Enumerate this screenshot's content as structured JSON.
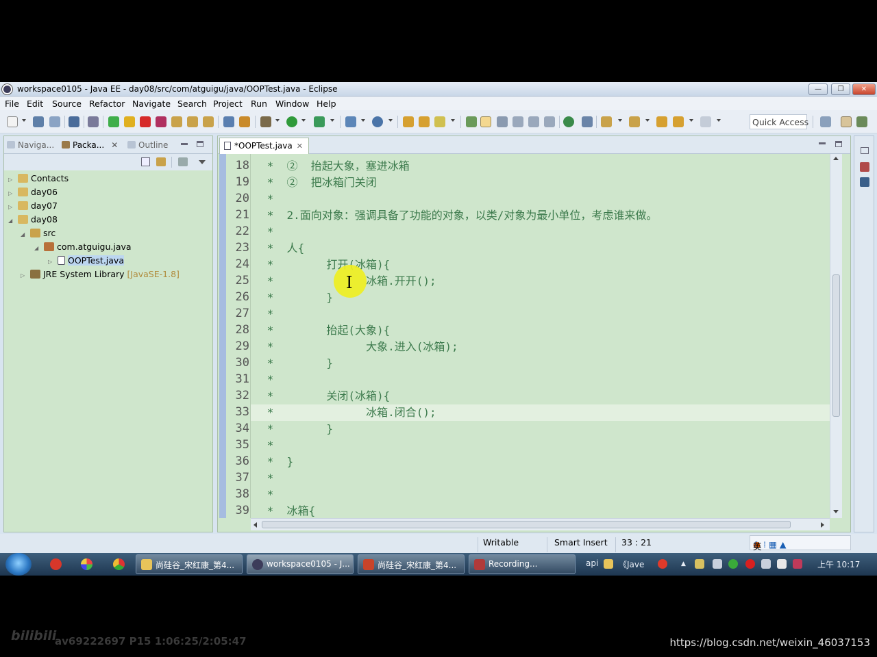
{
  "window": {
    "title": "workspace0105 - Java EE - day08/src/com/atguigu/java/OOPTest.java - Eclipse",
    "controls": [
      "—",
      "❐",
      "✕"
    ]
  },
  "menu": [
    "File",
    "Edit",
    "Source",
    "Refactor",
    "Navigate",
    "Search",
    "Project",
    "Run",
    "Window",
    "Help"
  ],
  "toolbar": {
    "quick_access": "Quick Access"
  },
  "left_panel": {
    "tabs": [
      {
        "label": "Naviga...",
        "active": false
      },
      {
        "label": "Packa...",
        "active": true
      },
      {
        "label": "Outline",
        "active": false
      }
    ],
    "tab_close": "✕",
    "tree": [
      {
        "label": "Contacts",
        "depth": 0,
        "toggle": "▷"
      },
      {
        "label": "day06",
        "depth": 0,
        "toggle": "▷"
      },
      {
        "label": "day07",
        "depth": 0,
        "toggle": "▷"
      },
      {
        "label": "day08",
        "depth": 0,
        "toggle": "◢"
      },
      {
        "label": "src",
        "depth": 1,
        "toggle": "◢"
      },
      {
        "label": "com.atguigu.java",
        "depth": 2,
        "toggle": "◢"
      },
      {
        "label": "OOPTest.java",
        "depth": 3,
        "toggle": "▷"
      },
      {
        "label": "JRE System Library",
        "suffix": "[JavaSE-1.8]",
        "depth": 1,
        "toggle": "▷"
      }
    ]
  },
  "editor": {
    "tab_label": "*OOPTest.java",
    "tab_close": "✕",
    "current_line": 33,
    "lines": [
      {
        "n": "18",
        "text": " *  ②  抬起大象，塞进冰箱"
      },
      {
        "n": "19",
        "text": " *  ②  把冰箱门关闭"
      },
      {
        "n": "20",
        "text": " *"
      },
      {
        "n": "21",
        "text": " *  2.面向对象：强调具备了功能的对象，以类/对象为最小单位，考虑谁来做。"
      },
      {
        "n": "22",
        "text": " *"
      },
      {
        "n": "23",
        "text": " *  人{"
      },
      {
        "n": "24",
        "text": " *        打开(冰箱){"
      },
      {
        "n": "25",
        "text": " *              冰箱.开开();"
      },
      {
        "n": "26",
        "text": " *        }"
      },
      {
        "n": "27",
        "text": " *"
      },
      {
        "n": "28",
        "text": " *        抬起(大象){"
      },
      {
        "n": "29",
        "text": " *              大象.进入(冰箱);"
      },
      {
        "n": "30",
        "text": " *        }"
      },
      {
        "n": "31",
        "text": " *"
      },
      {
        "n": "32",
        "text": " *        关闭(冰箱){"
      },
      {
        "n": "33",
        "text": " *              冰箱.闭合();"
      },
      {
        "n": "34",
        "text": " *        }"
      },
      {
        "n": "35",
        "text": " *"
      },
      {
        "n": "36",
        "text": " *  }"
      },
      {
        "n": "37",
        "text": " *"
      },
      {
        "n": "38",
        "text": " *"
      },
      {
        "n": "39",
        "text": " *  冰箱{"
      }
    ]
  },
  "status": {
    "writable": "Writable",
    "insert_mode": "Smart Insert",
    "position": "33 : 21",
    "ime": "英"
  },
  "taskbar": {
    "buttons": [
      {
        "label": "尚硅谷_宋红康_第4...",
        "active": false
      },
      {
        "label": "workspace0105 - J...",
        "active": true
      },
      {
        "label": "尚硅谷_宋红康_第4...",
        "active": false
      },
      {
        "label": "Recording...",
        "active": false
      }
    ],
    "tray_text_api": "api",
    "tray_text_java": "《Jave",
    "clock": "上午 10:17"
  },
  "overlay": {
    "bilibili_logo": "bilibili",
    "video_info": "av69222697 P15 1:06:25/2:05:47",
    "csdn_url": "https://blog.csdn.net/weixin_46037153"
  },
  "colors": {
    "editor_bg": "#cfe6cc",
    "comment_text": "#3c7a4c",
    "current_line_bg": "#e3f0e0",
    "cursor_highlight": "#eeee1e"
  }
}
